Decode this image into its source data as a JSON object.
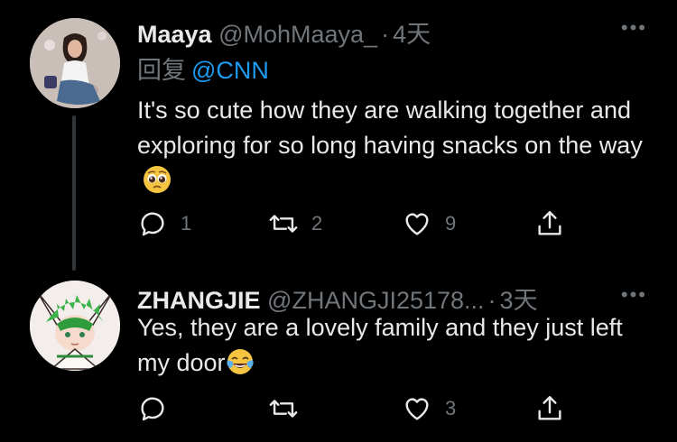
{
  "tweets": [
    {
      "name": "Maaya",
      "handle": "@MohMaaya_",
      "separator": "·",
      "time": "4天",
      "reply_prefix": "回复",
      "reply_mention": "@CNN",
      "text": "It's so cute how they are walking together and exploring for so long having snacks on the way",
      "emoji": "pleading-face-emoji",
      "actions": {
        "replies": "1",
        "retweets": "2",
        "likes": "9",
        "share": ""
      },
      "more_label": "•••"
    },
    {
      "name": "ZHANGJIE",
      "handle": "@ZHANGJI25178...",
      "separator": "·",
      "time": "3天",
      "text": "Yes, they are a lovely family and they just left my door",
      "emoji": "tears-of-joy-emoji",
      "actions": {
        "replies": "",
        "retweets": "",
        "likes": "3",
        "share": ""
      },
      "more_label": "•••"
    }
  ],
  "colors": {
    "background": "#000000",
    "text": "#e7e9ea",
    "secondary": "#71767b",
    "link": "#1d9bf0",
    "thread_line": "#333639"
  },
  "icons": [
    "reply-icon",
    "retweet-icon",
    "like-icon",
    "share-icon",
    "more-icon"
  ]
}
